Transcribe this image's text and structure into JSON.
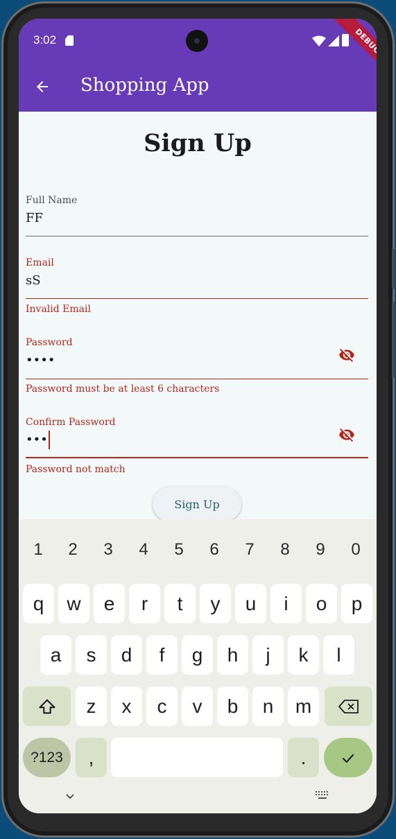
{
  "status": {
    "time": "3:02",
    "debug": "DEBUG"
  },
  "appbar": {
    "title": "Shopping App"
  },
  "page": {
    "title": "Sign Up"
  },
  "form": {
    "full_name": {
      "label": "Full Name",
      "value": "FF"
    },
    "email": {
      "label": "Email",
      "value": "sS",
      "error": "Invalid Email"
    },
    "password": {
      "label": "Password",
      "value": "••••",
      "error": "Password must be at least 6 characters"
    },
    "confirm_password": {
      "label": "Confirm Password",
      "value": "•••",
      "error": "Password not match"
    },
    "submit_label": "Sign Up"
  },
  "keyboard": {
    "numbers": [
      "1",
      "2",
      "3",
      "4",
      "5",
      "6",
      "7",
      "8",
      "9",
      "0"
    ],
    "row1": [
      "q",
      "w",
      "e",
      "r",
      "t",
      "y",
      "u",
      "i",
      "o",
      "p"
    ],
    "row2": [
      "a",
      "s",
      "d",
      "f",
      "g",
      "h",
      "j",
      "k",
      "l"
    ],
    "row3": [
      "z",
      "x",
      "c",
      "v",
      "b",
      "n",
      "m"
    ],
    "symbols_label": "?123",
    "comma": ",",
    "period": "."
  },
  "colors": {
    "primary": "#673ab7",
    "error": "#b3261e",
    "background": "#f3f9f9"
  },
  "icons": [
    "back-arrow-icon",
    "visibility-off-icon",
    "shift-icon",
    "backspace-icon",
    "check-icon",
    "chevron-down-icon",
    "keyboard-icon"
  ]
}
